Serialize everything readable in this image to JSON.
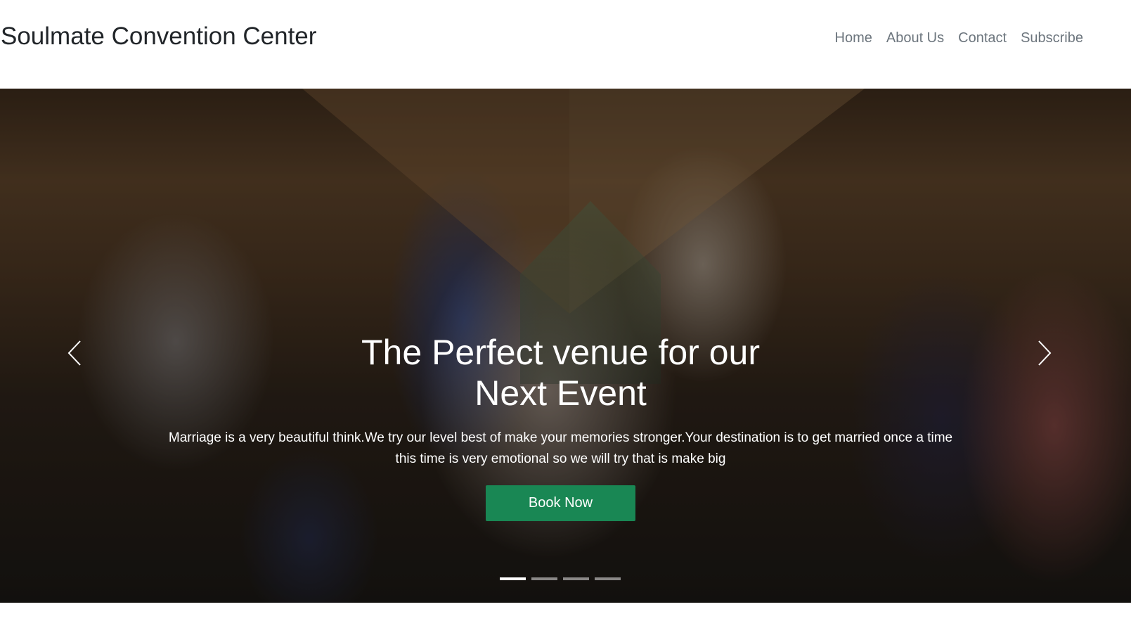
{
  "navbar": {
    "brand": "Soulmate Convention Center",
    "links": [
      "Home",
      "About Us",
      "Contact",
      "Subscribe"
    ]
  },
  "hero": {
    "title": "The Perfect venue for our Next Event",
    "text": "Marriage is a very beautiful think.We try our level best of make your memories stronger.Your destination is to get married once a time this time is very emotional so we will try that is make big",
    "button": "Book Now",
    "slide_count": 4,
    "active_slide": 1
  },
  "colors": {
    "brand_text": "#212529",
    "nav_text": "#6c757d",
    "button": "#198754"
  },
  "icons": {
    "prev": "chevron-left-icon",
    "next": "chevron-right-icon"
  }
}
